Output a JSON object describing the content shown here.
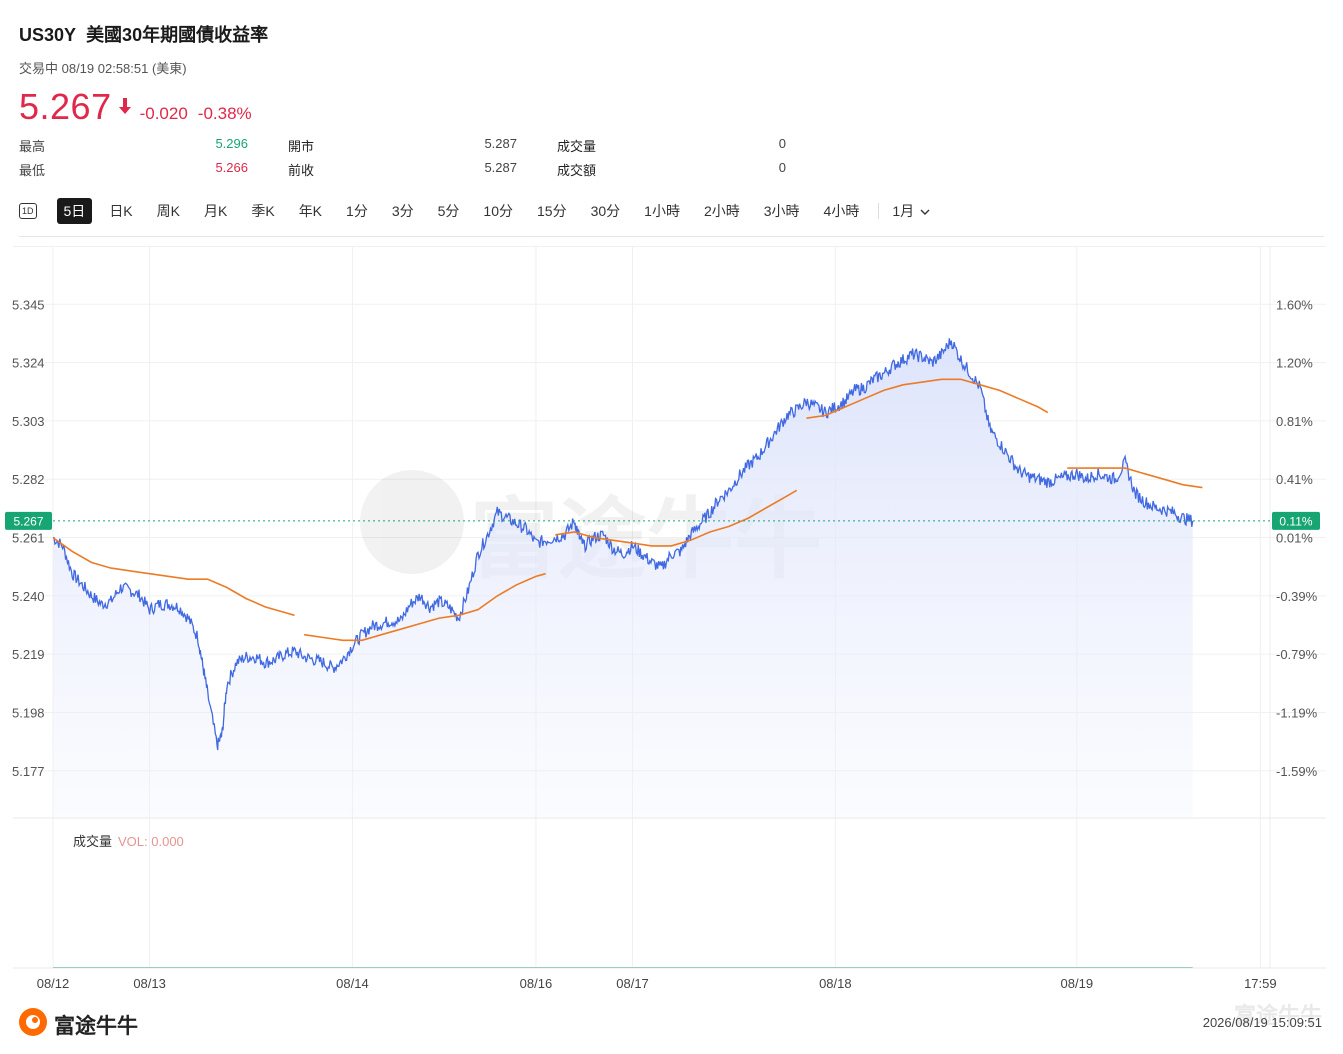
{
  "header": {
    "symbol": "US30Y",
    "name": "美國30年期國債收益率",
    "status": "交易中 08/19 02:58:51 (美東)",
    "price": "5.267",
    "change": "-0.020",
    "change_pct": "-0.38%",
    "down_color": "#e0284b",
    "up_color": "#17a673"
  },
  "stats": {
    "high_label": "最高",
    "high_value": "5.296",
    "low_label": "最低",
    "low_value": "5.266",
    "open_label": "開市",
    "open_value": "5.287",
    "prev_label": "前收",
    "prev_value": "5.287",
    "volume_label": "成交量",
    "volume_value": "0",
    "turnover_label": "成交額",
    "turnover_value": "0"
  },
  "tabs": [
    "5日",
    "日K",
    "周K",
    "月K",
    "季K",
    "年K",
    "1分",
    "3分",
    "5分",
    "10分",
    "15分",
    "30分",
    "1小時",
    "2小時",
    "3小時",
    "4小時"
  ],
  "tab_icon_label": "1D",
  "active_tab": "5日",
  "dropdown_label": "1月",
  "volume_panel": {
    "label": "成交量",
    "value": "VOL: 0.000"
  },
  "watermark": "富途牛牛",
  "footer": {
    "logo_text": "富途牛牛",
    "timestamp": "2026/08/19 15:09:51"
  },
  "chart_data": {
    "type": "line",
    "title": "",
    "y_left_ticks": [
      "5.345",
      "5.324",
      "5.303",
      "5.282",
      "5.261",
      "5.240",
      "5.219",
      "5.198",
      "5.177"
    ],
    "y_left_values": [
      5.345,
      5.324,
      5.303,
      5.282,
      5.261,
      5.24,
      5.219,
      5.198,
      5.177
    ],
    "y_right_ticks": [
      "1.60%",
      "1.20%",
      "0.81%",
      "0.41%",
      "0.01%",
      "-0.39%",
      "-0.79%",
      "-1.19%",
      "-1.59%"
    ],
    "ylim": [
      5.16,
      5.366
    ],
    "x_tick_labels": [
      "08/12",
      "08/13",
      "08/14",
      "08/16",
      "08/17",
      "08/18",
      "08/19",
      "17:59"
    ],
    "x_tick_positions": [
      0,
      10,
      31,
      50,
      60,
      81,
      106,
      125
    ],
    "x_range": [
      0,
      126
    ],
    "current_value": 5.267,
    "current_label_left": "5.267",
    "current_label_right": "0.11%",
    "series": [
      {
        "name": "",
        "color": "#4169e1",
        "values": [
          [
            0,
            5.261
          ],
          [
            1,
            5.258
          ],
          [
            2,
            5.248
          ],
          [
            3,
            5.244
          ],
          [
            4,
            5.24
          ],
          [
            5,
            5.237
          ],
          [
            6,
            5.238
          ],
          [
            7,
            5.243
          ],
          [
            8,
            5.242
          ],
          [
            9,
            5.24
          ],
          [
            10,
            5.235
          ],
          [
            11,
            5.237
          ],
          [
            12,
            5.237
          ],
          [
            13,
            5.236
          ],
          [
            14,
            5.232
          ],
          [
            15,
            5.225
          ],
          [
            15.5,
            5.215
          ],
          [
            16,
            5.205
          ],
          [
            17,
            5.186
          ],
          [
            17.5,
            5.19
          ],
          [
            18,
            5.208
          ],
          [
            19,
            5.216
          ],
          [
            20,
            5.218
          ],
          [
            21,
            5.218
          ],
          [
            22,
            5.216
          ],
          [
            23,
            5.217
          ],
          [
            24,
            5.219
          ],
          [
            25,
            5.22
          ],
          [
            26,
            5.218
          ],
          [
            27,
            5.217
          ],
          [
            28,
            5.216
          ],
          [
            29,
            5.214
          ],
          [
            30,
            5.217
          ],
          [
            31,
            5.222
          ],
          [
            32,
            5.226
          ],
          [
            33,
            5.229
          ],
          [
            34,
            5.23
          ],
          [
            35,
            5.231
          ],
          [
            36,
            5.231
          ],
          [
            37,
            5.237
          ],
          [
            38,
            5.24
          ],
          [
            39,
            5.236
          ],
          [
            40,
            5.238
          ],
          [
            41,
            5.236
          ],
          [
            42,
            5.232
          ],
          [
            43,
            5.242
          ],
          [
            44,
            5.255
          ],
          [
            45,
            5.262
          ],
          [
            46,
            5.27
          ],
          [
            47,
            5.268
          ],
          [
            48,
            5.266
          ],
          [
            49,
            5.264
          ],
          [
            50,
            5.259
          ],
          [
            51,
            5.26
          ],
          [
            52,
            5.261
          ],
          [
            53,
            5.262
          ],
          [
            54,
            5.267
          ],
          [
            54.5,
            5.261
          ],
          [
            55,
            5.258
          ],
          [
            56,
            5.261
          ],
          [
            57,
            5.262
          ],
          [
            58,
            5.257
          ],
          [
            59,
            5.255
          ],
          [
            60,
            5.258
          ],
          [
            61,
            5.255
          ],
          [
            62,
            5.252
          ],
          [
            63,
            5.25
          ],
          [
            64,
            5.255
          ],
          [
            65,
            5.256
          ],
          [
            66,
            5.262
          ],
          [
            67,
            5.266
          ],
          [
            68,
            5.27
          ],
          [
            69,
            5.275
          ],
          [
            70,
            5.278
          ],
          [
            71,
            5.283
          ],
          [
            72,
            5.287
          ],
          [
            73,
            5.29
          ],
          [
            74,
            5.295
          ],
          [
            75,
            5.3
          ],
          [
            76,
            5.305
          ],
          [
            77,
            5.307
          ],
          [
            78,
            5.31
          ],
          [
            79,
            5.308
          ],
          [
            80,
            5.306
          ],
          [
            81,
            5.308
          ],
          [
            82,
            5.31
          ],
          [
            83,
            5.314
          ],
          [
            84,
            5.315
          ],
          [
            85,
            5.318
          ],
          [
            86,
            5.32
          ],
          [
            87,
            5.323
          ],
          [
            88,
            5.325
          ],
          [
            89,
            5.327
          ],
          [
            90,
            5.326
          ],
          [
            91,
            5.324
          ],
          [
            92,
            5.327
          ],
          [
            93,
            5.332
          ],
          [
            94,
            5.325
          ],
          [
            95,
            5.32
          ],
          [
            96,
            5.315
          ],
          [
            97,
            5.3
          ],
          [
            98,
            5.295
          ],
          [
            99,
            5.29
          ],
          [
            100,
            5.285
          ],
          [
            101,
            5.283
          ],
          [
            102,
            5.282
          ],
          [
            103,
            5.281
          ],
          [
            104,
            5.282
          ],
          [
            105,
            5.283
          ],
          [
            106,
            5.284
          ],
          [
            107,
            5.282
          ],
          [
            108,
            5.284
          ],
          [
            109,
            5.283
          ],
          [
            110,
            5.282
          ],
          [
            111,
            5.288
          ],
          [
            112,
            5.277
          ],
          [
            113,
            5.274
          ],
          [
            114,
            5.272
          ],
          [
            115,
            5.271
          ],
          [
            116,
            5.27
          ],
          [
            117,
            5.268
          ],
          [
            118,
            5.267
          ]
        ]
      },
      {
        "name": "",
        "color": "#ec7b26",
        "segments": [
          [
            [
              0,
              5.261
            ],
            [
              2,
              5.256
            ],
            [
              4,
              5.252
            ],
            [
              6,
              5.25
            ],
            [
              8,
              5.249
            ],
            [
              10,
              5.248
            ],
            [
              12,
              5.247
            ],
            [
              14,
              5.246
            ],
            [
              16,
              5.246
            ],
            [
              18,
              5.243
            ],
            [
              20,
              5.239
            ],
            [
              22,
              5.236
            ],
            [
              24,
              5.234
            ],
            [
              25,
              5.233
            ]
          ],
          [
            [
              26,
              5.226
            ],
            [
              28,
              5.225
            ],
            [
              30,
              5.224
            ],
            [
              32,
              5.224
            ],
            [
              34,
              5.226
            ],
            [
              36,
              5.228
            ],
            [
              38,
              5.23
            ],
            [
              40,
              5.232
            ],
            [
              42,
              5.233
            ],
            [
              44,
              5.235
            ],
            [
              46,
              5.24
            ],
            [
              48,
              5.244
            ],
            [
              50,
              5.247
            ],
            [
              51,
              5.248
            ]
          ],
          [
            [
              52,
              5.262
            ],
            [
              54,
              5.263
            ],
            [
              56,
              5.261
            ],
            [
              58,
              5.26
            ],
            [
              60,
              5.259
            ],
            [
              62,
              5.258
            ],
            [
              64,
              5.258
            ],
            [
              66,
              5.26
            ],
            [
              68,
              5.263
            ],
            [
              70,
              5.265
            ],
            [
              72,
              5.268
            ],
            [
              74,
              5.272
            ],
            [
              76,
              5.276
            ],
            [
              77,
              5.278
            ]
          ],
          [
            [
              78,
              5.304
            ],
            [
              80,
              5.305
            ],
            [
              82,
              5.308
            ],
            [
              84,
              5.311
            ],
            [
              86,
              5.314
            ],
            [
              88,
              5.316
            ],
            [
              90,
              5.317
            ],
            [
              92,
              5.318
            ],
            [
              94,
              5.318
            ],
            [
              96,
              5.316
            ],
            [
              98,
              5.314
            ],
            [
              100,
              5.311
            ],
            [
              102,
              5.308
            ],
            [
              103,
              5.306
            ]
          ],
          [
            [
              105,
              5.286
            ],
            [
              107,
              5.286
            ],
            [
              109,
              5.286
            ],
            [
              111,
              5.286
            ],
            [
              113,
              5.284
            ],
            [
              115,
              5.282
            ],
            [
              117,
              5.28
            ],
            [
              119,
              5.279
            ]
          ]
        ]
      }
    ],
    "volume": {
      "values": [
        0
      ]
    },
    "grid": true,
    "legend": "none"
  }
}
